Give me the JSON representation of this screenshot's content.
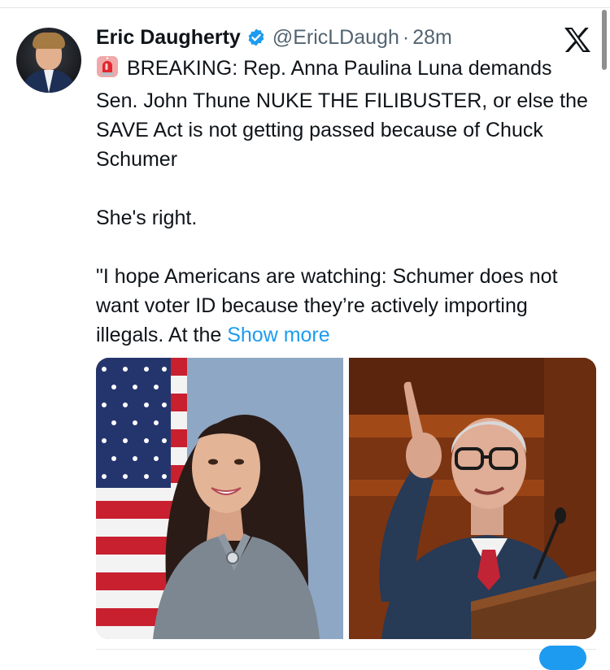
{
  "author": {
    "name": "Eric Daugherty",
    "handle": "@EricLDaugh",
    "separator": "·",
    "time": "28m",
    "verified": true
  },
  "tweet": {
    "line1": "BREAKING: Rep. Anna Paulina Luna demands Sen. John Thune NUKE THE FILIBUSTER, or else the SAVE Act is not getting passed because of Chuck Schumer",
    "line2": "She's right.",
    "line3": "\"I hope Americans are watching: Schumer does not want voter ID because they’re actively importing illegals. At the",
    "show_more": "Show more"
  },
  "icons": {
    "siren": "police-light-icon",
    "verified": "verified-badge-icon",
    "platform": "x-logo-icon"
  },
  "colors": {
    "link": "#1d9bf0",
    "text": "#0f1419",
    "secondary": "#536471",
    "verified": "#1d9bf0"
  }
}
